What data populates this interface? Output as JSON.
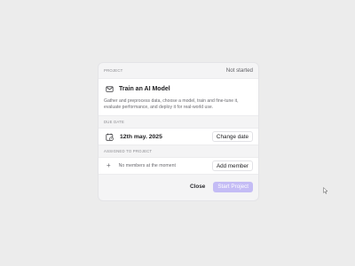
{
  "project": {
    "section_label": "PROJECT",
    "status": "Not started",
    "icon": "mail-icon",
    "title": "Train an AI Model",
    "description": "Gather and preprocess data, choose a model, train and fine-tune it, evaluate performance, and deploy it for real-world use."
  },
  "due_date": {
    "section_label": "DUE DATE",
    "icon": "calendar-icon",
    "value": "12th may. 2025",
    "change_label": "Change date"
  },
  "assigned": {
    "section_label": "ASSIGNED TO PROJECT",
    "icon": "plus-icon",
    "plus_symbol": "+",
    "empty_text": "No members at the moment",
    "add_label": "Add member"
  },
  "footer": {
    "close_label": "Close",
    "start_label": "Start Project"
  },
  "colors": {
    "background": "#ececec",
    "card": "#f4f4f5",
    "primary_disabled": "#c4bcf5"
  }
}
